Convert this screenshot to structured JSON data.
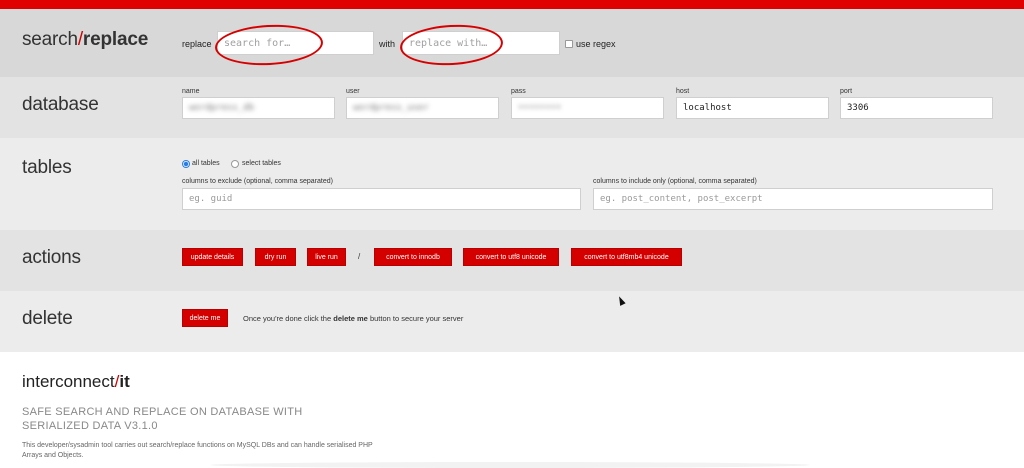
{
  "search": {
    "heading_part1": "search",
    "heading_slash": "/",
    "heading_part2": "replace",
    "replace_label": "replace",
    "search_placeholder": "search for…",
    "with_label": "with",
    "replace_placeholder": "replace with…",
    "regex_label": "use regex"
  },
  "database": {
    "heading": "database",
    "fields": [
      {
        "label": "name",
        "value": "wordpress_db"
      },
      {
        "label": "user",
        "value": "wordpress_user"
      },
      {
        "label": "pass",
        "value": "••••••••"
      },
      {
        "label": "host",
        "value": "localhost"
      },
      {
        "label": "port",
        "value": "3306"
      }
    ]
  },
  "tables": {
    "heading": "tables",
    "all_tables_label": "all tables",
    "select_tables_label": "select tables",
    "exclude_label": "columns to exclude (optional, comma separated)",
    "exclude_placeholder": "eg. guid",
    "include_label": "columns to include only (optional, comma separated)",
    "include_placeholder": "eg. post_content, post_excerpt"
  },
  "actions": {
    "heading": "actions",
    "update_details": "update details",
    "dry_run": "dry run",
    "live_run": "live run",
    "separator": "/",
    "convert_innodb": "convert to innodb",
    "convert_utf8": "convert to utf8 unicode",
    "convert_utf8mb4": "convert to utf8mb4 unicode"
  },
  "delete": {
    "heading": "delete",
    "button": "delete me",
    "note_before": "Once you're done click the",
    "note_bold": "delete me",
    "note_after": "button to secure your server"
  },
  "footer": {
    "brand_part1": "interconnect",
    "brand_slash": "/",
    "brand_part2": "it",
    "tagline": "SAFE SEARCH AND REPLACE ON DATABASE WITH SERIALIZED DATA V3.1.0",
    "description": "This developer/sysadmin tool carries out search/replace functions on MySQL DBs and can handle serialised PHP Arrays and Objects."
  },
  "colors": {
    "accent": "#d40000",
    "top_bar": "#e00000"
  }
}
